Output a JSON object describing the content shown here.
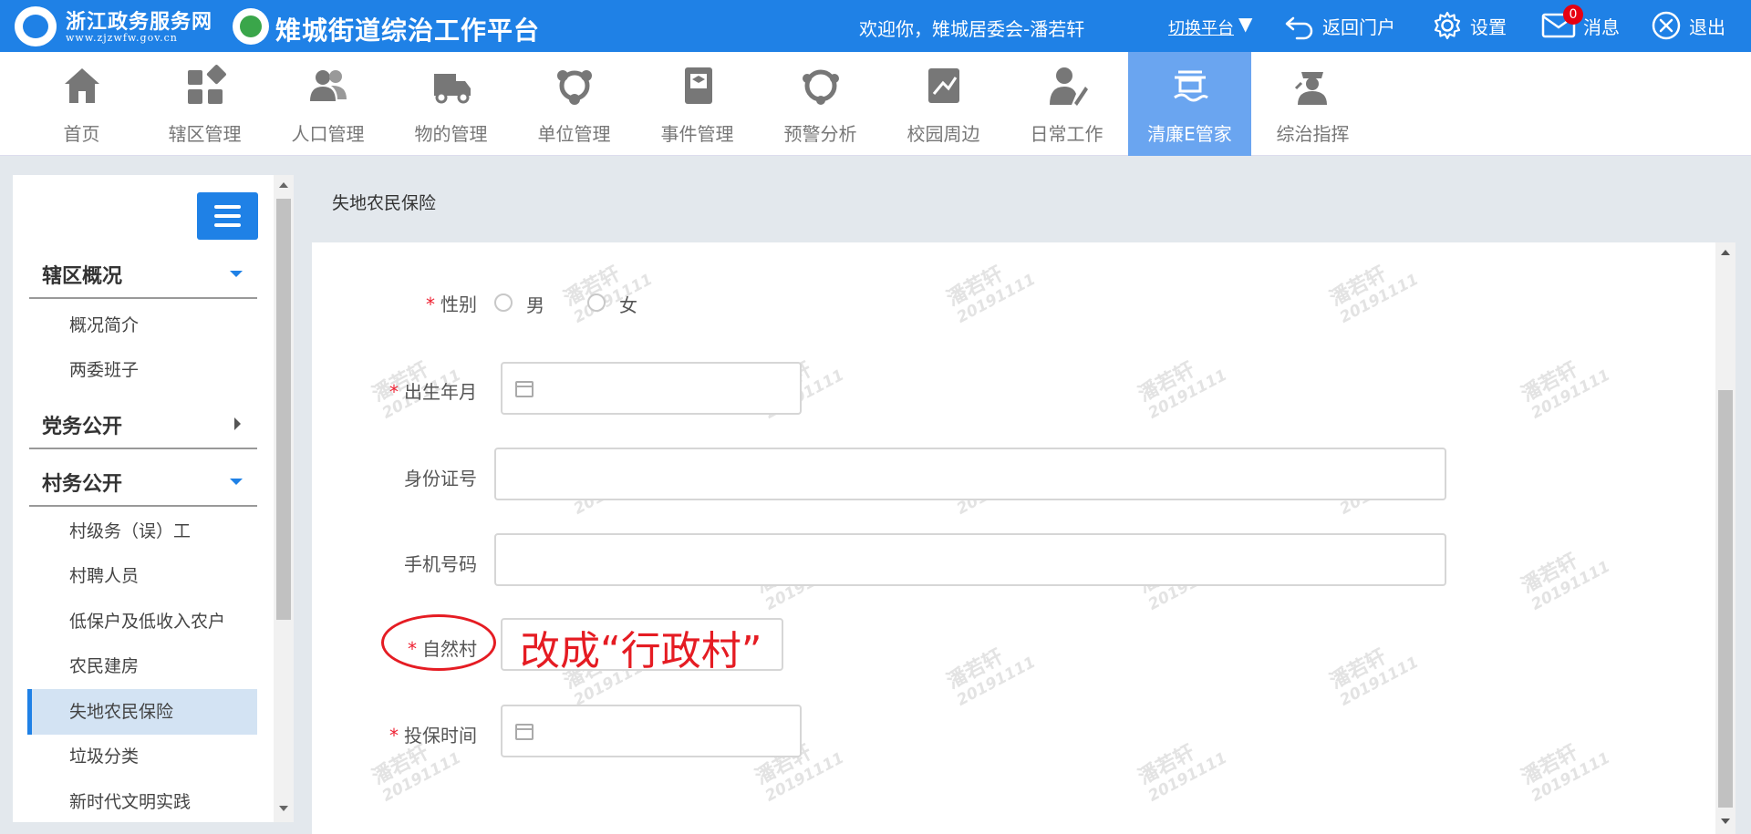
{
  "header": {
    "site_name": "浙江政务服务网",
    "site_url": "www.zjzwfw.gov.cn",
    "platform_title": "雉城街道综治工作平台",
    "welcome": "欢迎你，雉城居委会-潘若轩",
    "switch_platform": "切换平台",
    "switch_arrow": "▼",
    "return_portal": "返回门户",
    "settings": "设置",
    "messages": "消息",
    "message_count": "0",
    "logout": "退出",
    "accent_color": "#1f81e6"
  },
  "nav": {
    "items": [
      {
        "label": "首页",
        "icon": "home-icon"
      },
      {
        "label": "辖区管理",
        "icon": "grid-icon"
      },
      {
        "label": "人口管理",
        "icon": "people-icon"
      },
      {
        "label": "物的管理",
        "icon": "truck-icon"
      },
      {
        "label": "单位管理",
        "icon": "network-icon"
      },
      {
        "label": "事件管理",
        "icon": "notebook-icon"
      },
      {
        "label": "预警分析",
        "icon": "alert-icon"
      },
      {
        "label": "校园周边",
        "icon": "campus-icon"
      },
      {
        "label": "日常工作",
        "icon": "worker-icon"
      },
      {
        "label": "清廉E管家",
        "icon": "building-icon"
      },
      {
        "label": "综治指挥",
        "icon": "police-icon"
      }
    ],
    "active_index": 9
  },
  "sidebar": {
    "groups": [
      {
        "label": "辖区概况",
        "items": [
          "概况简介",
          "两委班子"
        ]
      },
      {
        "label": "党务公开",
        "items": []
      },
      {
        "label": "村务公开",
        "items": [
          "村级务（误）工",
          "村聘人员",
          "低保户及低收入农户",
          "农民建房",
          "失地农民保险",
          "垃圾分类",
          "新时代文明实践"
        ]
      }
    ],
    "active_item": "失地农民保险"
  },
  "page": {
    "title": "失地农民保险"
  },
  "form": {
    "gender_label": "性别",
    "gender_options": [
      "男",
      "女"
    ],
    "birth_label": "出生年月",
    "birth_value": "",
    "id_label": "身份证号",
    "id_value": "",
    "phone_label": "手机号码",
    "phone_value": "",
    "village_label": "自然村",
    "village_value": "",
    "insure_time_label": "投保时间",
    "insure_time_value": "",
    "required_mark": "*"
  },
  "watermark": {
    "name": "潘若轩",
    "date": "20191111"
  },
  "annotation": {
    "text": "改成“行政村”",
    "color": "#e51c23"
  }
}
